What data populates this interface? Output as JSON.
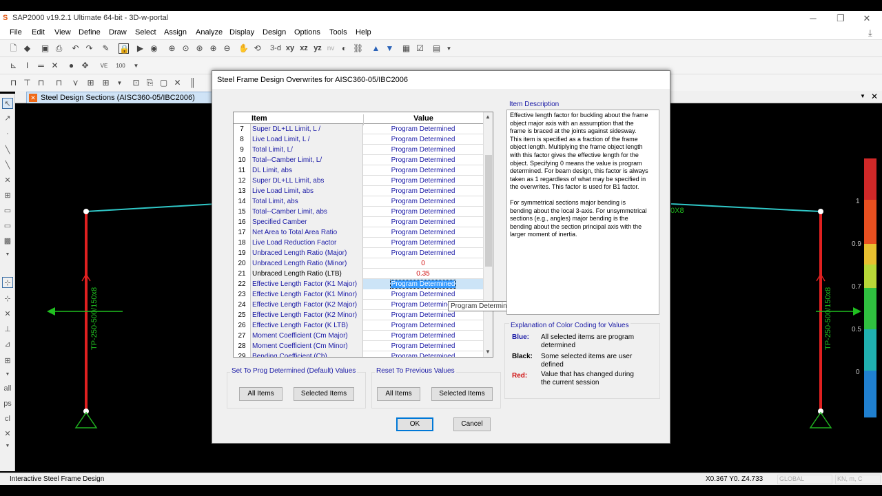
{
  "window": {
    "title": "SAP2000 v19.2.1 Ultimate 64-bit - 3D-w-portal",
    "minimize": "─",
    "restore": "❐",
    "close": "✕"
  },
  "menu": [
    "File",
    "Edit",
    "View",
    "Define",
    "Draw",
    "Select",
    "Assign",
    "Analyze",
    "Display",
    "Design",
    "Options",
    "Tools",
    "Help"
  ],
  "toolbar": {
    "view_3d": "3-d",
    "view_xy": "xy",
    "view_xz": "xz",
    "view_yz": "yz",
    "view_nv": "nv"
  },
  "doc_tab": {
    "label": "Steel Design Sections  (AISC360-05/IBC2006)",
    "close": "✕",
    "dropdown": "▼"
  },
  "viewport": {
    "frame_labels": [
      "TP-250-500/150x8",
      "TP-250-500/150x8"
    ],
    "beam_label_partial": "0X8",
    "scale_labels": [
      "1",
      "0.9",
      "0.7",
      "0.5",
      "0"
    ],
    "scale_colors": [
      "#d02828",
      "#e85020",
      "#e8c030",
      "#b8d838",
      "#30c040",
      "#20b0b0",
      "#2080d0"
    ]
  },
  "status": {
    "left": "Interactive Steel Frame Design",
    "coords": "X0.367  Y0.  Z4.733",
    "coord_system": "GLOBAL",
    "units": "KN, m, C"
  },
  "dialog": {
    "title": "Steel Frame Design Overwrites for AISC360-05/IBC2006",
    "grid": {
      "header_item": "Item",
      "header_value": "Value",
      "rows": [
        {
          "num": "7",
          "item": "Super DL+LL Limit, L /",
          "value": "Program Determined",
          "style": "blue"
        },
        {
          "num": "8",
          "item": "Live Load Limit, L /",
          "value": "Program Determined",
          "style": "blue"
        },
        {
          "num": "9",
          "item": "Total Limit, L/",
          "value": "Program Determined",
          "style": "blue"
        },
        {
          "num": "10",
          "item": "Total--Camber Limit, L/",
          "value": "Program Determined",
          "style": "blue"
        },
        {
          "num": "11",
          "item": "DL Limit, abs",
          "value": "Program Determined",
          "style": "blue"
        },
        {
          "num": "12",
          "item": "Super DL+LL Limit, abs",
          "value": "Program Determined",
          "style": "blue"
        },
        {
          "num": "13",
          "item": "Live Load Limit, abs",
          "value": "Program Determined",
          "style": "blue"
        },
        {
          "num": "14",
          "item": "Total Limit, abs",
          "value": "Program Determined",
          "style": "blue"
        },
        {
          "num": "15",
          "item": "Total--Camber Limit, abs",
          "value": "Program Determined",
          "style": "blue"
        },
        {
          "num": "16",
          "item": "Specified Camber",
          "value": "Program Determined",
          "style": "blue"
        },
        {
          "num": "17",
          "item": "Net Area to Total Area Ratio",
          "value": "Program Determined",
          "style": "blue"
        },
        {
          "num": "18",
          "item": "Live Load Reduction Factor",
          "value": "Program Determined",
          "style": "blue"
        },
        {
          "num": "19",
          "item": "Unbraced Length Ratio (Major)",
          "value": "Program Determined",
          "style": "blue"
        },
        {
          "num": "20",
          "item": "Unbraced Length Ratio (Minor)",
          "value": "0",
          "style": "red"
        },
        {
          "num": "21",
          "item": "Unbraced Length Ratio (LTB)",
          "value": "0.35",
          "style": "red-black"
        },
        {
          "num": "22",
          "item": "Effective Length Factor (K1 Major)",
          "value": "Program Determined",
          "style": "selected"
        },
        {
          "num": "23",
          "item": "Effective Length Factor (K1 Minor)",
          "value": "Program Determined",
          "style": "blue"
        },
        {
          "num": "24",
          "item": "Effective Length Factor (K2 Major)",
          "value": "Program Determined",
          "style": "blue"
        },
        {
          "num": "25",
          "item": "Effective Length Factor (K2 Minor)",
          "value": "Program Determined",
          "style": "blue"
        },
        {
          "num": "26",
          "item": "Effective Length Factor (K LTB)",
          "value": "Program Determined",
          "style": "blue"
        },
        {
          "num": "27",
          "item": "Moment Coefficient (Cm Major)",
          "value": "Program Determined",
          "style": "blue"
        },
        {
          "num": "28",
          "item": "Moment Coefficient (Cm Minor)",
          "value": "Program Determined",
          "style": "blue"
        },
        {
          "num": "29",
          "item": "Bending Coefficient (Cb)",
          "value": "Program Determined",
          "style": "blue"
        }
      ],
      "tooltip": "Program Determined"
    },
    "description": {
      "label": "Item Description",
      "p1": "Effective length factor for buckling about the frame object major axis with an assumption that the frame is braced at the joints against sidesway.  This item is specified as a fraction of the frame object length.  Multiplying the frame object length with this factor gives the effective length for the object.  Specifying 0 means the value is program determined.  For beam design, this factor is always taken as 1 regardless of what may be specified in the overwrites.  This factor is used for B1 factor.",
      "p2": "For symmetrical sections major bending is bending about the local 3-axis.  For unsymmetrical sections (e.g., angles) major bending is the bending about the section principal axis with the larger moment of inertia."
    },
    "color_coding": {
      "title": "Explanation of Color Coding for Values",
      "blue_key": "Blue:",
      "blue_text": "All selected items are program determined",
      "black_key": "Black:",
      "black_text": "Some selected items are user defined",
      "red_key": "Red:",
      "red_text": "Value that has changed during the current session"
    },
    "set_default": {
      "title": "Set To Prog Determined (Default) Values",
      "all": "All Items",
      "selected": "Selected Items"
    },
    "reset_previous": {
      "title": "Reset To Previous Values",
      "all": "All Items",
      "selected": "Selected Items"
    },
    "ok": "OK",
    "cancel": "Cancel"
  }
}
